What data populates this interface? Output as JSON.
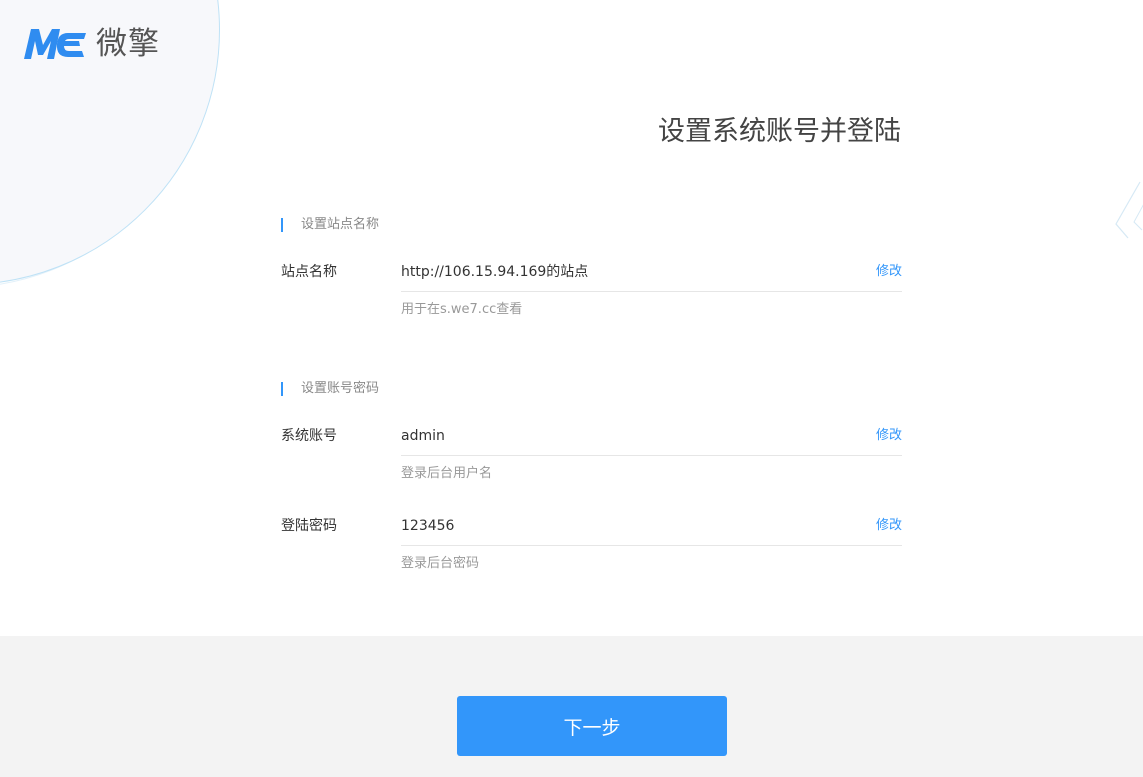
{
  "brand": {
    "logo_mark": "ME",
    "name": "微擎"
  },
  "page_title": "设置系统账号并登陆",
  "sections": [
    {
      "title": "设置站点名称",
      "rows": [
        {
          "label": "站点名称",
          "value": "http://106.15.94.169的站点",
          "edit_label": "修改",
          "hint": "用于在s.we7.cc查看"
        }
      ]
    },
    {
      "title": "设置账号密码",
      "rows": [
        {
          "label": "系统账号",
          "value": "admin",
          "edit_label": "修改",
          "hint": "登录后台用户名"
        },
        {
          "label": "登陆密码",
          "value": "123456",
          "edit_label": "修改",
          "hint": "登录后台密码"
        }
      ]
    }
  ],
  "footer": {
    "next_label": "下一步"
  },
  "colors": {
    "accent": "#3296fa",
    "logo_blue": "#2f8cf0",
    "footer_bg": "#f3f3f3"
  }
}
